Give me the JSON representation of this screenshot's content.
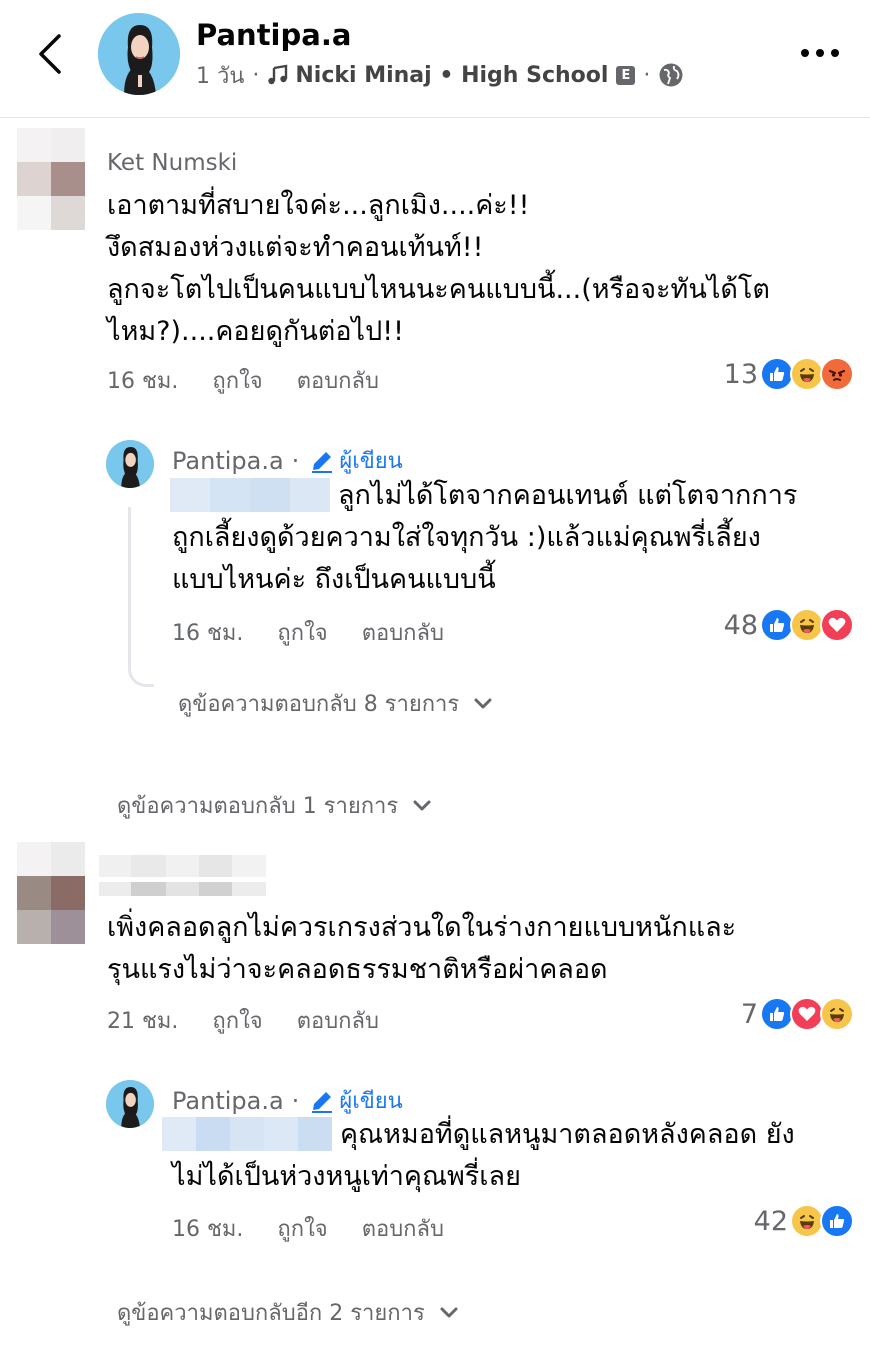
{
  "header": {
    "name": "Pantipa.a",
    "time": "1 วัน",
    "song": "Nicki Minaj • High School",
    "explicit": "E",
    "colors": {
      "accent": "#1877f2",
      "muted": "#65676b"
    }
  },
  "comments": [
    {
      "name": "Ket Numski",
      "lines": [
        "เอาตามที่สบายใจค่ะ...ลูกเมิง....ค่ะ!!",
        "งึดสมองห่วงแต่จะทำคอนเท้นท์!!",
        "ลูกจะโตไปเป็นคนแบบไหนนะคนแบบนี้...(หรือจะทันได้โต",
        "ไหม?)....คอยดูกันต่อไป!!"
      ],
      "time": "16 ชม.",
      "like": "ถูกใจ",
      "reply": "ตอบกลับ",
      "reaction_count": "13",
      "reply_item": {
        "name": "Pantipa.a",
        "badge": "ผู้เขียน",
        "lines": [
          "ลูกไม่ได้โตจากคอนเทนต์ แต่โตจากการ",
          "ถูกเลี้ยงดูด้วยความใส่ใจทุกวัน :)แล้วแม่คุณพรี่เลี้ยง",
          "แบบไหนค่ะ ถึงเป็นคนแบบนี้"
        ],
        "time": "16 ชม.",
        "like": "ถูกใจ",
        "reply": "ตอบกลับ",
        "reaction_count": "48"
      },
      "view_nested": "ดูข้อความตอบกลับ 8 รายการ",
      "view_more": "ดูข้อความตอบกลับ 1 รายการ"
    },
    {
      "lines": [
        "เพิ่งคลอดลูกไม่ควรเกรงส่วนใดในร่างกายแบบหนักและ",
        "รุนแรงไม่ว่าจะคลอดธรรมชาติหรือผ่าคลอด"
      ],
      "time": "21 ชม.",
      "like": "ถูกใจ",
      "reply": "ตอบกลับ",
      "reaction_count": "7",
      "reply_item": {
        "name": "Pantipa.a",
        "badge": "ผู้เขียน",
        "lines": [
          "คุณหมอที่ดูแลหนูมาตลอดหลังคลอด ยัง",
          "ไม่ได้เป็นห่วงหนูเท่าคุณพรี่เลย"
        ],
        "time": "16 ชม.",
        "like": "ถูกใจ",
        "reply": "ตอบกลับ",
        "reaction_count": "42"
      },
      "view_more": "ดูข้อความตอบกลับอีก 2 รายการ"
    }
  ]
}
